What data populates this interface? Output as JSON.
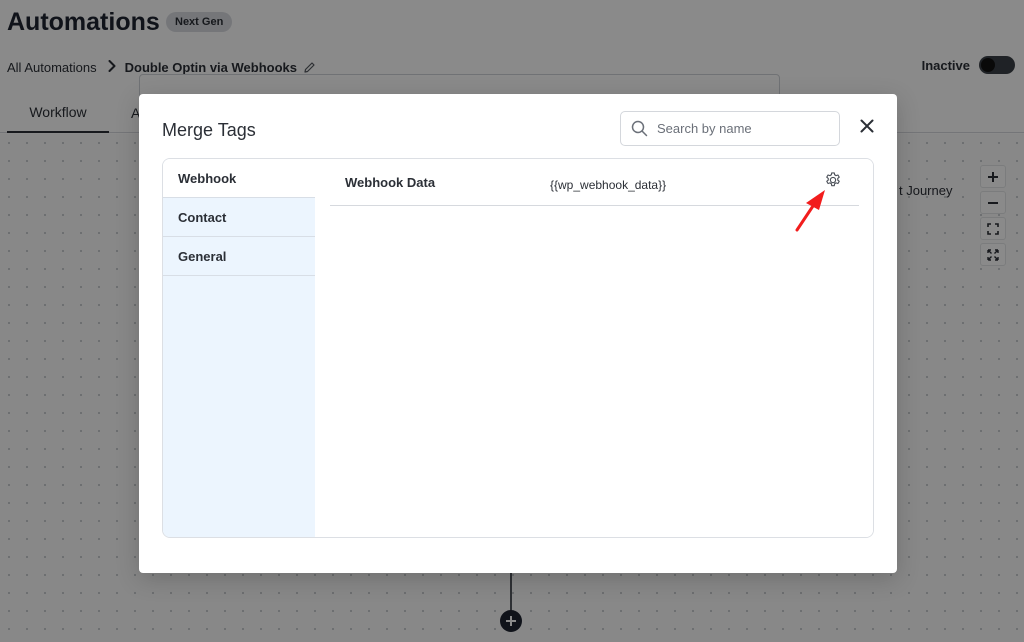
{
  "header": {
    "title": "Automations",
    "badge": "Next Gen"
  },
  "breadcrumb": {
    "root": "All Automations",
    "current": "Double Optin via Webhooks"
  },
  "status": {
    "label": "Inactive",
    "enabled": false
  },
  "tabs": [
    {
      "label": "Workflow",
      "active": true
    },
    {
      "label": "A",
      "active": false
    }
  ],
  "canvas": {
    "journey_label": "t Journey"
  },
  "zoom_controls": [
    "zoom-in",
    "zoom-out",
    "fit-screen",
    "fullscreen"
  ],
  "modal": {
    "title": "Merge Tags",
    "search_placeholder": "Search by name",
    "search_value": "",
    "categories": [
      {
        "label": "Webhook",
        "active": true
      },
      {
        "label": "Contact",
        "active": false
      },
      {
        "label": "General",
        "active": false
      }
    ],
    "tags": [
      {
        "name": "Webhook Data",
        "value": "{{wp_webhook_data}}",
        "icon": "gear-icon"
      }
    ]
  },
  "annotation": {
    "arrow_color": "#f21d1d"
  },
  "colors": {
    "sidebar_bg": "#ecf5fe",
    "text": "#2b2f36",
    "overlay": "rgba(0,0,0,0.46)"
  }
}
